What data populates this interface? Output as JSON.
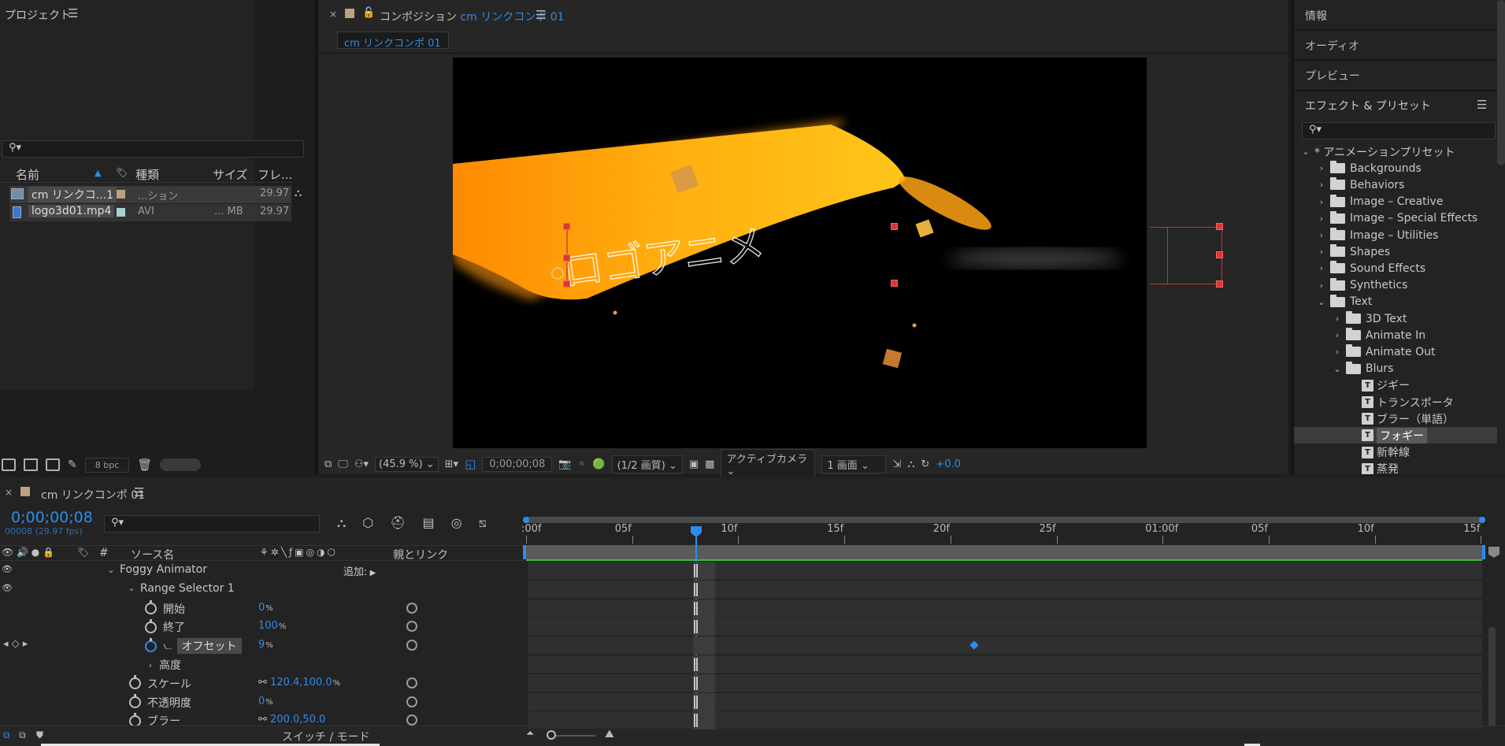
{
  "project": {
    "title": "プロジェクト",
    "search_placeholder": "",
    "columns": {
      "name": "名前",
      "type": "種類",
      "size": "サイズ",
      "frame": "フレ..."
    },
    "items": [
      {
        "name": "cm リンクコ...1",
        "type": "...ション",
        "size": "",
        "frame": "29.97",
        "swatch": "#bba27e"
      },
      {
        "name": "logo3d01.mp4",
        "type": "AVI",
        "size": "... MB",
        "frame": "29.97",
        "swatch": "#a8d0d0"
      }
    ],
    "bpc": "8 bpc"
  },
  "composition": {
    "title_prefix": "コンポジション",
    "title_name": "cm リンクコンポ 01",
    "tab": "cm リンクコンポ 01",
    "canvas_text": "ロゴアニメ",
    "footer": {
      "zoom": "(45.9 %)",
      "timecode": "0;00;00;08",
      "resolution": "(1/2 画質)",
      "camera": "アクティブカメラ",
      "views": "1 画面",
      "exposure": "+0.0"
    }
  },
  "right_panels": {
    "info": "情報",
    "audio": "オーディオ",
    "preview": "プレビュー",
    "effects": "エフェクト & プリセット"
  },
  "effects_tree": [
    {
      "label": "* アニメーションプリセット",
      "level": 0,
      "kind": "root"
    },
    {
      "label": "Backgrounds",
      "level": 1,
      "kind": "folder"
    },
    {
      "label": "Behaviors",
      "level": 1,
      "kind": "folder"
    },
    {
      "label": "Image – Creative",
      "level": 1,
      "kind": "folder"
    },
    {
      "label": "Image – Special Effects",
      "level": 1,
      "kind": "folder"
    },
    {
      "label": "Image – Utilities",
      "level": 1,
      "kind": "folder"
    },
    {
      "label": "Shapes",
      "level": 1,
      "kind": "folder"
    },
    {
      "label": "Sound Effects",
      "level": 1,
      "kind": "folder"
    },
    {
      "label": "Synthetics",
      "level": 1,
      "kind": "folder"
    },
    {
      "label": "Text",
      "level": 1,
      "kind": "open"
    },
    {
      "label": "3D Text",
      "level": 2,
      "kind": "folder"
    },
    {
      "label": "Animate In",
      "level": 2,
      "kind": "folder"
    },
    {
      "label": "Animate Out",
      "level": 2,
      "kind": "folder"
    },
    {
      "label": "Blurs",
      "level": 2,
      "kind": "open"
    },
    {
      "label": "ジギー",
      "level": 3,
      "kind": "preset"
    },
    {
      "label": "トランスポータ",
      "level": 3,
      "kind": "preset"
    },
    {
      "label": "ブラー（単語）",
      "level": 3,
      "kind": "preset"
    },
    {
      "label": "フォギー",
      "level": 3,
      "kind": "preset",
      "selected": true
    },
    {
      "label": "新幹線",
      "level": 3,
      "kind": "preset"
    },
    {
      "label": "蒸発",
      "level": 3,
      "kind": "preset"
    }
  ],
  "timeline": {
    "tab": "cm リンクコンポ 01",
    "timecode": "0;00;00;08",
    "fps": "00008 (29.97 fps)",
    "header": {
      "source": "ソース名",
      "parent": "親とリンク",
      "num": "#"
    },
    "ruler": [
      ":00f",
      "05f",
      "10f",
      "15f",
      "20f",
      "25f",
      "01:00f",
      "05f",
      "10f",
      "15f"
    ],
    "switch_mode": "スイッチ / モード",
    "layers": [
      {
        "name": "Foggy Animator",
        "extra": "追加:"
      },
      {
        "name": "Range Selector 1"
      },
      {
        "name": "開始",
        "value": "0",
        "unit": "%"
      },
      {
        "name": "終了",
        "value": "100",
        "unit": "%"
      },
      {
        "name": "オフセット",
        "value": "9",
        "unit": "%"
      },
      {
        "name": "高度"
      },
      {
        "name": "スケール",
        "value": "120.4,100.0",
        "unit": "%"
      },
      {
        "name": "不透明度",
        "value": "0",
        "unit": "%"
      },
      {
        "name": "ブラー",
        "value": "200.0,50.0"
      }
    ]
  }
}
